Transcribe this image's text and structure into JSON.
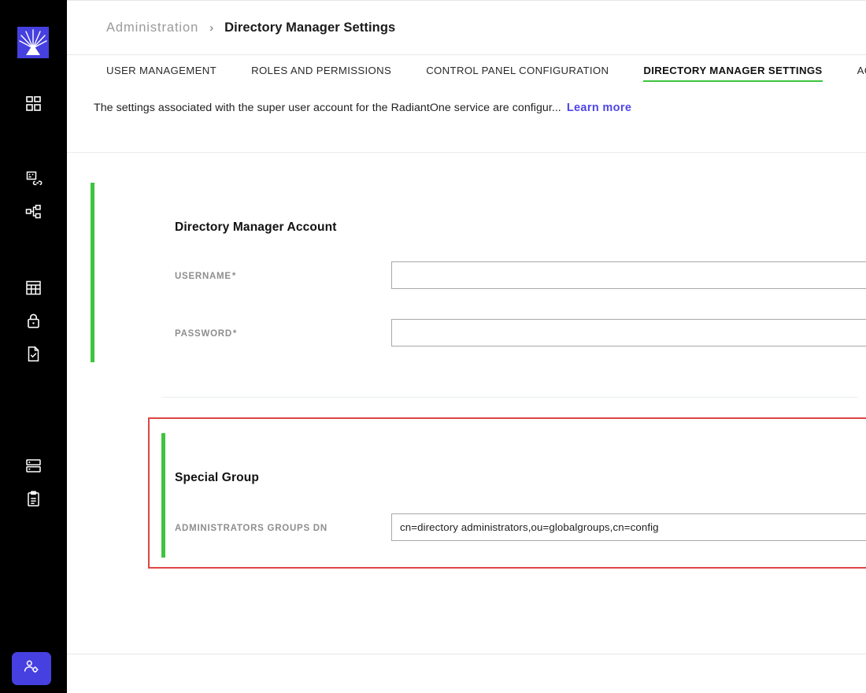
{
  "sidebar": {
    "logo": {
      "name": "radiantone-logo",
      "color": "#4640e0"
    },
    "items": [
      {
        "icon": "dashboard-grid-icon",
        "name": "sidebar-item-dashboard"
      },
      {
        "icon": "data-source-link-icon",
        "name": "sidebar-item-data-sources"
      },
      {
        "icon": "hierarchy-tree-icon",
        "name": "sidebar-item-directory-tree"
      },
      {
        "icon": "table-grid-icon",
        "name": "sidebar-item-schema"
      },
      {
        "icon": "lock-icon",
        "name": "sidebar-item-security"
      },
      {
        "icon": "document-check-icon",
        "name": "sidebar-item-policies"
      },
      {
        "icon": "server-stack-icon",
        "name": "sidebar-item-servers"
      },
      {
        "icon": "clipboard-icon",
        "name": "sidebar-item-logs"
      }
    ],
    "user_button": {
      "icon": "user-settings-icon",
      "name": "user-settings-button",
      "color": "#4640e0"
    }
  },
  "header": {
    "breadcrumb": {
      "root": "Administration",
      "separator": "›",
      "current": "Directory Manager Settings"
    }
  },
  "tabs": [
    {
      "label": "USER MANAGEMENT",
      "active": false
    },
    {
      "label": "ROLES AND PERMISSIONS",
      "active": false
    },
    {
      "label": "CONTROL PANEL CONFIGURATION",
      "active": false
    },
    {
      "label": "DIRECTORY MANAGER SETTINGS",
      "active": true
    },
    {
      "label": "ACCESS",
      "active": false
    }
  ],
  "description": {
    "text": "The settings associated with the super user account for the RadiantOne service are configur...",
    "link_label": "Learn more"
  },
  "sections": {
    "directory_manager_account": {
      "title": "Directory Manager Account",
      "username": {
        "label": "USERNAME",
        "required_marker": "*",
        "value": "",
        "placeholder": ""
      },
      "password": {
        "label": "PASSWORD",
        "required_marker": "*",
        "value": "",
        "placeholder": "",
        "action_icon": "pencil-edit-icon"
      }
    },
    "special_group": {
      "title": "Special Group",
      "administrators_groups_dn": {
        "label": "ADMINISTRATORS GROUPS DN",
        "value": "cn=directory administrators,ou=globalgroups,cn=config",
        "placeholder": "",
        "action_icon": "folder-browse-icon"
      },
      "highlighted": true
    }
  },
  "colors": {
    "accent_green": "#3ec43e",
    "highlight_red": "#e04545",
    "link_indigo": "#4f46e5",
    "brand_blue": "#4640e0",
    "sidebar_black": "#000000"
  }
}
